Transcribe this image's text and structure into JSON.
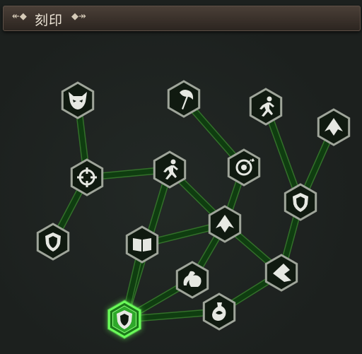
{
  "header": {
    "title": "刻印",
    "left_ornament": "↞◆",
    "right_ornament": "◆↠"
  },
  "colors": {
    "link": "#0f3d10",
    "link_edge": "#33702a",
    "node_fill": "#101a10",
    "node_border": "#9fa59a",
    "icon": "#e6e8e2",
    "active_fill": "#1c7a1a",
    "active_border": "#6bff5a"
  },
  "nodes": [
    {
      "id": "demon-mask",
      "icon": "demon-mask-icon",
      "active": false
    },
    {
      "id": "axe",
      "icon": "axe-icon",
      "active": false
    },
    {
      "id": "runner-top",
      "icon": "runner-icon",
      "active": false
    },
    {
      "id": "up-arrow-top",
      "icon": "up-arrow-icon",
      "active": false
    },
    {
      "id": "crosshair",
      "icon": "crosshair-icon",
      "active": false
    },
    {
      "id": "runner-mid",
      "icon": "runner-icon",
      "active": false
    },
    {
      "id": "target",
      "icon": "target-icon",
      "active": false
    },
    {
      "id": "shield-right",
      "icon": "shield-icon",
      "active": false
    },
    {
      "id": "shield-left",
      "icon": "shield-icon",
      "active": false
    },
    {
      "id": "up-arrow-mid",
      "icon": "up-arrow-icon",
      "active": false
    },
    {
      "id": "book",
      "icon": "book-icon",
      "active": false
    },
    {
      "id": "muscle",
      "icon": "muscle-icon",
      "active": false
    },
    {
      "id": "chevron",
      "icon": "chevron-left-icon",
      "active": false
    },
    {
      "id": "potion",
      "icon": "potion-icon",
      "active": false
    },
    {
      "id": "shield-start",
      "icon": "shield-icon",
      "active": true
    }
  ],
  "links": [
    [
      "demon-mask",
      "crosshair"
    ],
    [
      "crosshair",
      "shield-left"
    ],
    [
      "crosshair",
      "runner-mid"
    ],
    [
      "axe",
      "target"
    ],
    [
      "target",
      "up-arrow-mid"
    ],
    [
      "runner-mid",
      "up-arrow-mid"
    ],
    [
      "runner-mid",
      "shield-start"
    ],
    [
      "book",
      "up-arrow-mid"
    ],
    [
      "up-arrow-mid",
      "muscle"
    ],
    [
      "up-arrow-mid",
      "chevron"
    ],
    [
      "runner-top",
      "shield-right"
    ],
    [
      "up-arrow-top",
      "shield-right"
    ],
    [
      "shield-right",
      "chevron"
    ],
    [
      "chevron",
      "potion"
    ],
    [
      "muscle",
      "shield-start"
    ],
    [
      "potion",
      "shield-start"
    ],
    [
      "book",
      "shield-start"
    ]
  ]
}
